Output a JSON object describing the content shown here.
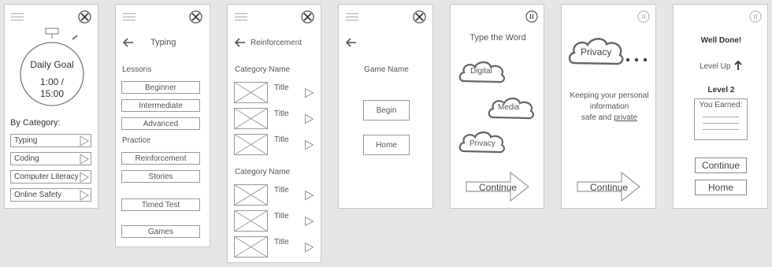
{
  "screen1": {
    "timer_title": "Daily Goal",
    "timer_value": "1:00 /",
    "timer_total": "15:00",
    "by_category_label": "By Category:",
    "categories": [
      "Typing",
      "Coding",
      "Computer Literacy",
      "Online Safety"
    ]
  },
  "screen2": {
    "title": "Typing",
    "lessons_label": "Lessons",
    "lessons": [
      "Beginner",
      "Intermediate",
      "Advanced"
    ],
    "practice_label": "Practice",
    "practice": [
      "Reinforcement",
      "Stories"
    ],
    "timed_test": "Timed Test",
    "games": "Games"
  },
  "screen3": {
    "title": "Reinforcement",
    "category_label_1": "Category Name",
    "category_label_2": "Category Name",
    "item_title": "Title"
  },
  "screen4": {
    "game_name": "Game Name",
    "begin": "Begin",
    "home": "Home"
  },
  "screen5": {
    "heading": "Type the Word",
    "words": [
      "Digital",
      "Media",
      "Privacy"
    ],
    "continue": "Continue"
  },
  "screen6": {
    "cloud_word": "Privacy",
    "ellipsis": "...",
    "desc_line1": "Keeping your personal",
    "desc_line2": "information",
    "desc_line3_a": "safe and",
    "desc_line3_b": "private",
    "continue": "Continue"
  },
  "screen7": {
    "well_done": "Well Done!",
    "level_up": "Level Up",
    "level": "Level 2",
    "you_earned": "You Earned:",
    "continue": "Continue",
    "home": "Home"
  }
}
